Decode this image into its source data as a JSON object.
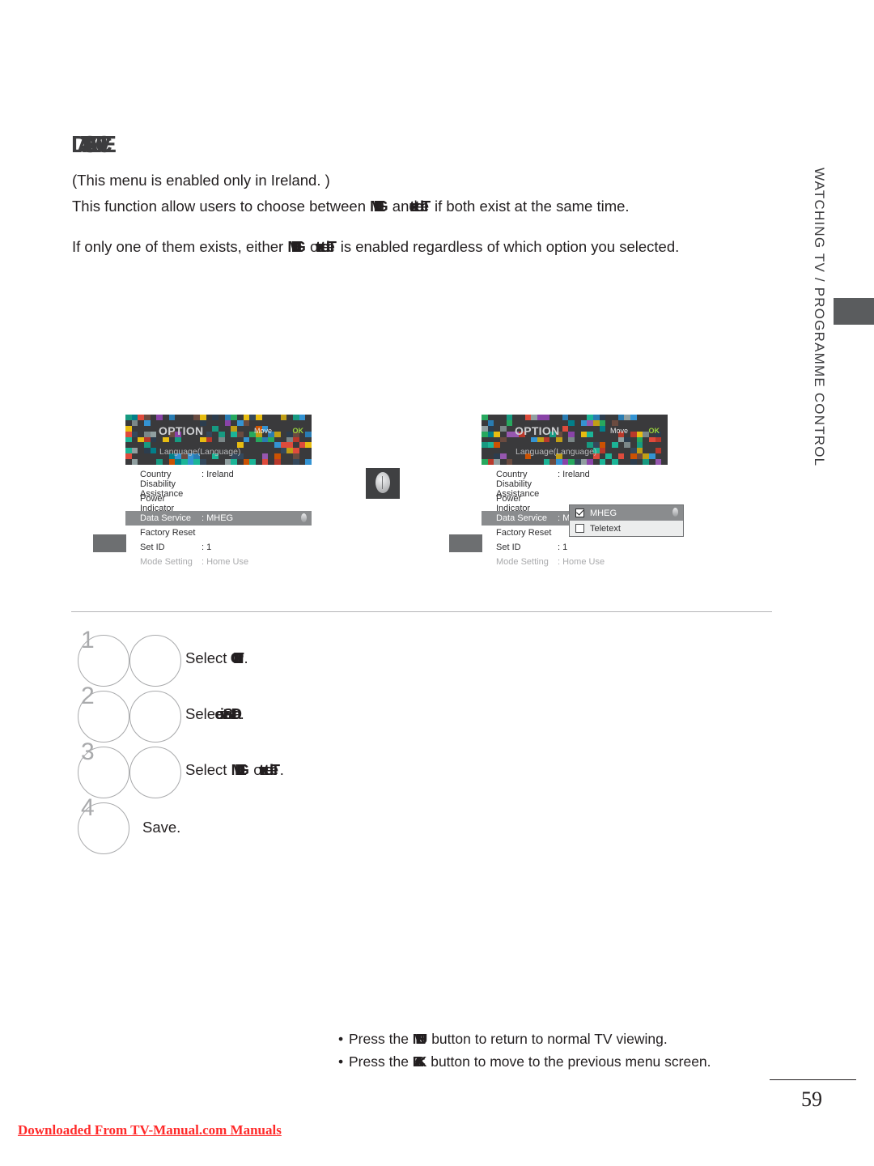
{
  "page": {
    "title": "DATA SERVICE",
    "number": "59",
    "watermark": "Downloaded From TV-Manual.com Manuals",
    "side_tab_label": "WATCHING TV / PROGRAMME CONTROL",
    "colors": {
      "accent_ok": "#9ad43c",
      "osd_header": "#3a3a3c",
      "osd_highlight": "#8a8c8e",
      "side_tab": "#5a5c5e",
      "watermark": "#ff2a2a",
      "divider": "#b4b5b7",
      "step_outline": "#a9aaac"
    }
  },
  "intro": {
    "note": "(This menu is enabled only in Ireland. )",
    "para1_a": "This function allow users to choose between ",
    "para1_term1": "MHEG",
    "para1_b": " and ",
    "para1_term2": "Teletext",
    "para1_c": " if both exist at the same time.",
    "para2_a": "If only one of them exists, either ",
    "para2_term1": "MHEG",
    "para2_b": " or ",
    "para2_term2": "Teletext",
    "para2_c": " is enabled regardless of which option you selected."
  },
  "osd": {
    "title": "OPTION",
    "subtitle": "Language(Language)",
    "move_label": "Move",
    "ok_label": "OK",
    "rows": [
      {
        "label": "Country",
        "value": ": Ireland",
        "state": "normal"
      },
      {
        "label": "Disability Assistance",
        "value": "",
        "state": "normal"
      },
      {
        "label": "Power Indicator",
        "value": "",
        "state": "normal"
      },
      {
        "label": "Data Service",
        "value": ": MHEG",
        "state": "selected"
      },
      {
        "label": "Factory Reset",
        "value": "",
        "state": "normal"
      },
      {
        "label": "Set ID",
        "value": ": 1",
        "state": "normal"
      },
      {
        "label": "Mode Setting",
        "value": ": Home Use",
        "state": "dim"
      }
    ],
    "dropdown": {
      "options": [
        {
          "label": "MHEG",
          "checked": true,
          "active": true
        },
        {
          "label": "Teletext",
          "checked": false,
          "active": false
        }
      ]
    }
  },
  "steps": [
    {
      "num": "1",
      "circles": 2,
      "text_a": "Select ",
      "term": "OPTION",
      "text_b": "."
    },
    {
      "num": "2",
      "circles": 2,
      "text_a": "Select ",
      "term": "Data Service",
      "text_b": "."
    },
    {
      "num": "3",
      "circles": 2,
      "text_a": "Select ",
      "term": "MHEG",
      "text_mid": " or ",
      "term2": "Teletext",
      "text_b": "."
    },
    {
      "num": "4",
      "circles": 1,
      "text_a": "Save.",
      "term": "",
      "text_b": ""
    }
  ],
  "notes": {
    "note1_a": "Press the ",
    "note1_term": "MENU",
    "note1_b": " button to return to normal TV viewing.",
    "note2_a": "Press the ",
    "note2_term": "BACK",
    "note2_b": " button to move to the previous menu screen."
  }
}
